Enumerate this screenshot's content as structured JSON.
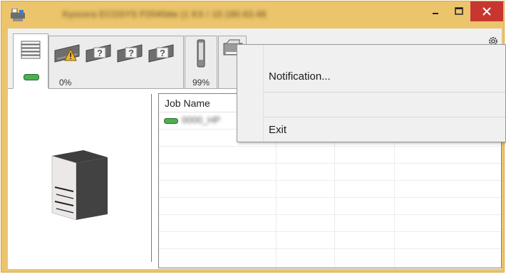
{
  "window": {
    "title": "Kyocera ECOSYS P2040dw (1 KX / 10.180.63.48",
    "controls": {
      "minimize": "minimize",
      "maximize": "maximize",
      "close": "close"
    }
  },
  "tabs": [
    {
      "id": "toner",
      "value": "0%",
      "icons": [
        "toner-stack-icon",
        "warning-toner-icon",
        "unknown-toner-icon",
        "unknown-toner-icon",
        "unknown-toner-icon"
      ]
    },
    {
      "id": "paper",
      "value": "99%",
      "icons": [
        "paper-tray-icon"
      ]
    },
    {
      "id": "device",
      "value": "",
      "icons": [
        "printer-device-icon"
      ]
    }
  ],
  "job_list": {
    "columns": [
      "Job Name"
    ],
    "rows": [
      {
        "name": "0000_HP",
        "status_icon": "job-status-icon"
      }
    ]
  },
  "context_menu": {
    "items": [
      {
        "label": "Notification..."
      },
      {
        "label": ""
      },
      {
        "label": "Exit"
      }
    ]
  },
  "colors": {
    "title_bar": "#ecc46b",
    "close_button": "#c7362f",
    "status_ok": "#4caf50"
  }
}
